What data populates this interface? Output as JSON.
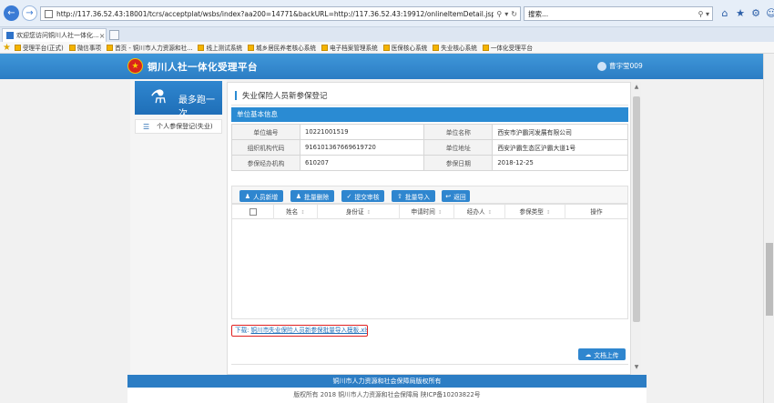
{
  "browser": {
    "url": "http://117.36.52.43:18001/tcrs/acceptplat/wsbs/index?aa200=14771&backURL=http://117.36.52.43:19912/onlineItemDetail.jspx&szz046=00000266&b",
    "search_placeholder": "搜索...",
    "tab_title": "欢迎您访问铜川人社一体化...",
    "favorites": [
      "受理平台(正式)",
      "微信事项",
      "首页 - 铜川市人力资源和社...",
      "线上测试系统",
      "城乡居民养老核心系统",
      "电子档案管理系统",
      "医保核心系统",
      "失业核心系统",
      "一体化受理平台"
    ]
  },
  "site": {
    "title": "铜川人社一体化受理平台",
    "user": "曹宇莹009"
  },
  "sidebar": {
    "banner": "最多跑一次",
    "items": [
      {
        "label": "个人参保登记(失业)"
      }
    ]
  },
  "main": {
    "page_title": "失业保险人员新参保登记",
    "section_title": "单位基本信息",
    "info": [
      {
        "label": "单位编号",
        "value": "10221001519",
        "label2": "单位名称",
        "value2": "西安市沪霸河发展有限公司"
      },
      {
        "label": "组织机构代码",
        "value": "916101367669619720",
        "label2": "单位地址",
        "value2": "西安沪霸生态区沪霸大道1号"
      },
      {
        "label": "参保经办机构",
        "value": "610207",
        "label2": "参保日期",
        "value2": "2018-12-25"
      }
    ],
    "buttons": {
      "add": "人员新增",
      "batch_delete": "批量删除",
      "submit": "提交审核",
      "batch_import": "批量导入",
      "back": "返回",
      "upload": "文档上传"
    },
    "columns": [
      "姓名",
      "身份证",
      "申请时间",
      "经办人",
      "参保类型",
      "操作"
    ],
    "download_label": "下载:",
    "download_link": "铜川市失业保险人员新参保批量导入模板.xls"
  },
  "footer": {
    "line1": "铜川市人力资源和社会保障局版权所有",
    "line2": "版权所有 2018 铜川市人力资源和社会保障局 陕ICP备10203822号"
  },
  "colors": {
    "accent": "#2a8bd3",
    "header": "#2c7dc4",
    "highlight_border": "#e02020"
  }
}
